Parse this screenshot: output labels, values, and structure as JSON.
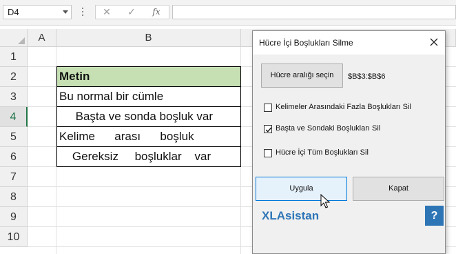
{
  "formula_bar": {
    "name_box": "D4",
    "cancel_symbol": "✕",
    "enter_symbol": "✓",
    "fx_label": "fx",
    "formula": ""
  },
  "sheet": {
    "columns": [
      "A",
      "B"
    ],
    "rows": [
      "1",
      "2",
      "3",
      "4",
      "5",
      "6",
      "7",
      "8",
      "9",
      "10"
    ],
    "active_row": "4",
    "cells": [
      {
        "ref": "B2",
        "text": "Metin"
      },
      {
        "ref": "B3",
        "text": "Bu normal bir cümle"
      },
      {
        "ref": "B4",
        "text": "     Başta ve sonda boşluk var"
      },
      {
        "ref": "B5",
        "text": "Kelime      arası      boşluk"
      },
      {
        "ref": "B6",
        "text": "    Gereksiz     boşluklar    var"
      }
    ],
    "header_fill": "#c6e0b4"
  },
  "dialog": {
    "title": "Hücre İçi Boşlukları Silme",
    "select_button": "Hücre aralığı seçin",
    "range": "$B$3:$B$6",
    "options": [
      {
        "label": "Kelimeler Arasındaki Fazla Boşlukları Sil",
        "checked": false
      },
      {
        "label": "Başta ve Sondaki Boşlukları Sil",
        "checked": true
      },
      {
        "label": "Hücre İçi Tüm Boşlukları Sil",
        "checked": false
      }
    ],
    "apply_button": "Uygula",
    "close_button": "Kapat",
    "brand": "XLAsistan",
    "help_button": "?",
    "brand_color": "#2e75b6"
  }
}
